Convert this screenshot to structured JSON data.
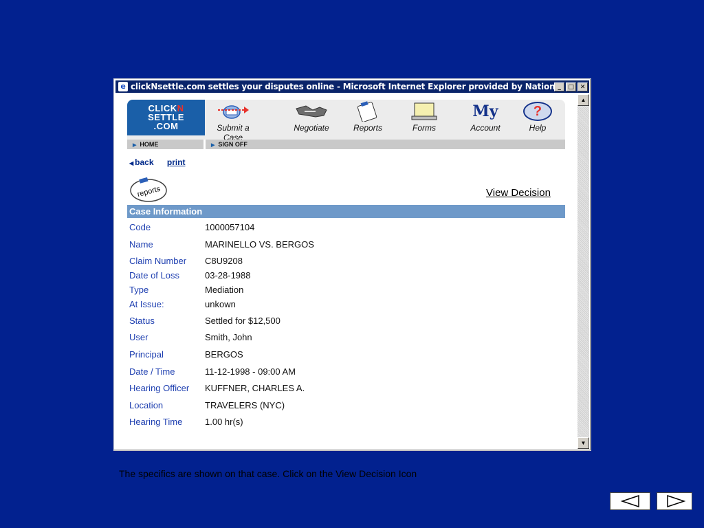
{
  "window": {
    "title": "clickNsettle.com settles your disputes online - Microsoft Internet Explorer provided by National Arb...",
    "min_glyph": "_",
    "max_glyph": "□",
    "close_glyph": "✕"
  },
  "logo": {
    "line1a": "CLICK",
    "line1b": "N",
    "line2": "SETTLE",
    "line3": ".COM"
  },
  "nav": [
    {
      "label": "Submit a Case",
      "icon": "submit-case-icon"
    },
    {
      "label": "Negotiate",
      "icon": "handshake-icon"
    },
    {
      "label": "Reports",
      "icon": "clipboard-icon"
    },
    {
      "label": "Forms",
      "icon": "laptop-icon"
    },
    {
      "label": "Account",
      "icon": "my-account-icon",
      "icon_text": "My"
    },
    {
      "label": "Help",
      "icon": "help-icon",
      "icon_text": "?"
    }
  ],
  "subnav": {
    "home": "HOME",
    "sign_off": "SIGN OFF"
  },
  "links": {
    "back": "back",
    "print": "print",
    "view_decision": "View Decision",
    "reports_icon_text": "reports"
  },
  "case": {
    "header": "Case Information",
    "rows": [
      {
        "key": "Code",
        "value": "1000057104"
      },
      {
        "key": "Name",
        "value": "MARINELLO VS. BERGOS"
      },
      {
        "key": "Claim Number",
        "value": "C8U9208"
      },
      {
        "key": "Date of Loss",
        "value": "03-28-1988"
      },
      {
        "key": "Type",
        "value": "Mediation"
      },
      {
        "key": "At Issue:",
        "value": "unkown"
      },
      {
        "key": "Status",
        "value": "Settled for $12,500"
      },
      {
        "key": "User",
        "value": " Smith, John"
      },
      {
        "key": "Principal",
        "value": "BERGOS"
      },
      {
        "key": "Date / Time",
        "value": "11-12-1998 - 09:00 AM"
      },
      {
        "key": "Hearing Officer",
        "value": "KUFFNER, CHARLES A."
      },
      {
        "key": "Location",
        "value": "TRAVELERS (NYC)"
      },
      {
        "key": "Hearing Time",
        "value": "1.00 hr(s)"
      }
    ]
  },
  "caption": "The specifics are shown on that case.  Click on the View Decision Icon",
  "colors": {
    "slide_bg": "#02218f",
    "header_bar": "#6e99c9",
    "label_blue": "#1e3fb0",
    "logo_blue": "#1a5fa8"
  }
}
